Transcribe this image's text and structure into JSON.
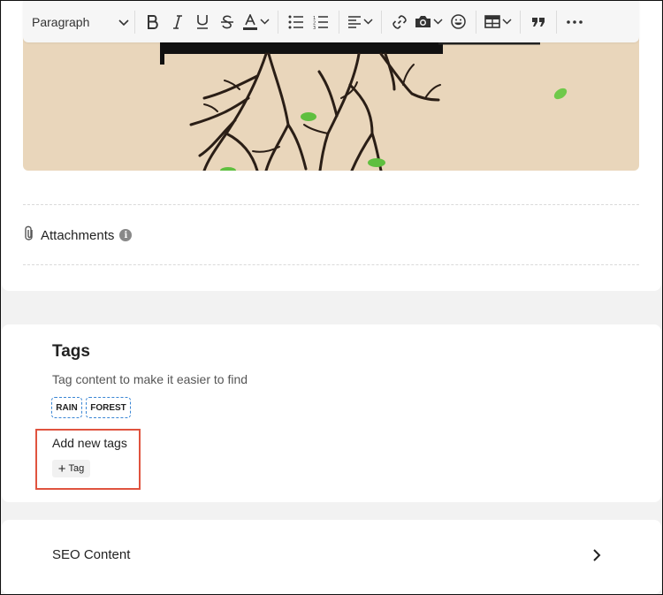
{
  "toolbar": {
    "paragraph_select": "Paragraph",
    "icons": [
      "bold-icon",
      "italic-icon",
      "underline-icon",
      "strikethrough-icon",
      "text-color-icon",
      "bulleted-list-icon",
      "numbered-list-icon",
      "align-icon",
      "link-icon",
      "image-icon",
      "emoji-icon",
      "table-icon",
      "quote-icon",
      "more-icon"
    ]
  },
  "attachments": {
    "label": "Attachments",
    "info": "i"
  },
  "tags": {
    "title": "Tags",
    "description": "Tag content to make it easier to find",
    "chips": [
      "RAIN",
      "FOREST"
    ],
    "add_title": "Add new tags",
    "add_button_plus": "+",
    "add_button_label": "Tag"
  },
  "seo": {
    "label": "SEO Content"
  },
  "colors": {
    "image_bg": "#e9d6bb",
    "tag_border": "#3a86d4",
    "highlight": "#e0533f"
  }
}
